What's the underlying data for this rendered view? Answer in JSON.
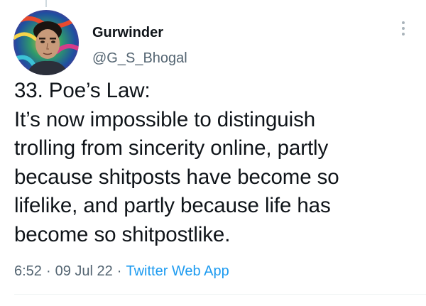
{
  "author": {
    "display_name": "Gurwinder",
    "handle": "@G_S_Bhogal",
    "avatar_icon": "user-avatar-photo"
  },
  "tweet": {
    "lines": [
      "33. Poe’s Law:",
      "It’s now impossible to distinguish",
      "trolling from sincerity online, partly",
      "because shitposts have become so",
      "lifelike, and partly because life has",
      "become so shitpostlike."
    ]
  },
  "meta": {
    "time": "6:52",
    "separator": "·",
    "date": "09 Jul 22",
    "source": "Twitter Web App"
  },
  "icons": {
    "more": "more-vertical-icon"
  },
  "colors": {
    "text": "#0f1419",
    "secondary": "#536471",
    "link": "#1d9bf0"
  }
}
